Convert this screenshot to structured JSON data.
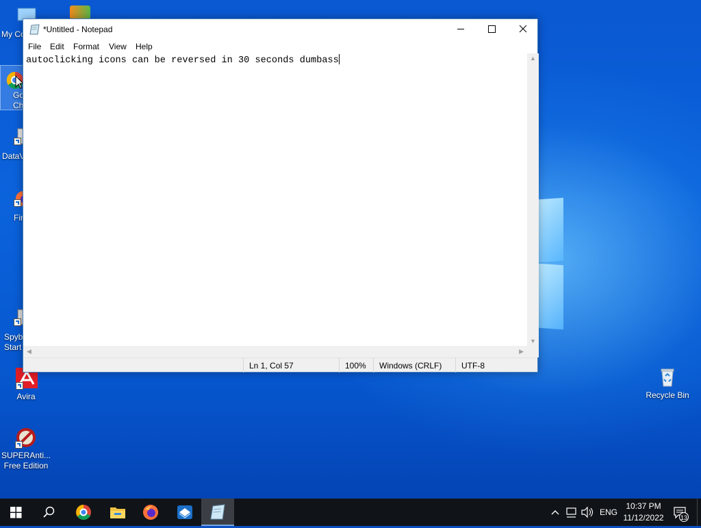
{
  "desktop": {
    "icons_left": [
      {
        "label": "My Co"
      },
      {
        "label": "Go\nCh"
      },
      {
        "label": "DataV"
      },
      {
        "label": "Fir"
      },
      {
        "label": "Spyb\nStart"
      },
      {
        "label": "Avira"
      },
      {
        "label": "SUPERAnti...\nFree Edition"
      }
    ],
    "recycle_bin": {
      "label": "Recycle Bin"
    }
  },
  "notepad": {
    "title": "*Untitled - Notepad",
    "menu": [
      "File",
      "Edit",
      "Format",
      "View",
      "Help"
    ],
    "content": "autoclicking icons can be reversed in 30 seconds dumbass",
    "status": {
      "position": "Ln 1, Col 57",
      "zoom": "100%",
      "line_ending": "Windows (CRLF)",
      "encoding": "UTF-8"
    }
  },
  "taskbar": {
    "pinned": [
      "start-icon",
      "search-icon",
      "chrome-icon",
      "file-explorer-icon",
      "firefox-icon",
      "app-icon",
      "notepad-icon"
    ],
    "tray": {
      "language": "ENG",
      "time": "10:37 PM",
      "date": "11/12/2022",
      "notification_count": "13"
    }
  }
}
